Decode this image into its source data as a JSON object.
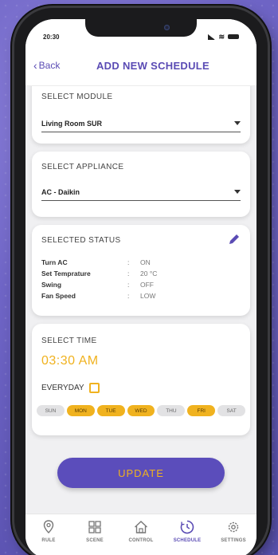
{
  "status_bar": {
    "time": "20:30"
  },
  "header": {
    "back_label": "Back",
    "title": "ADD NEW SCHEDULE"
  },
  "module": {
    "label": "SELECT MODULE",
    "value": "Living Room SUR"
  },
  "appliance": {
    "label": "SELECT APPLIANCE",
    "value": "AC - Daikin"
  },
  "selected_status": {
    "label": "SELECTED STATUS",
    "rows": [
      {
        "key": "Turn AC",
        "sep": ":",
        "value": "ON"
      },
      {
        "key": "Set Temprature",
        "sep": ":",
        "value": "20 °C"
      },
      {
        "key": "Swing",
        "sep": ":",
        "value": "OFF"
      },
      {
        "key": "Fan Speed",
        "sep": ":",
        "value": "LOW"
      }
    ]
  },
  "time": {
    "label": "SELECT TIME",
    "value": "03:30 AM",
    "everyday_label": "EVERYDAY",
    "everyday_checked": false,
    "days": [
      {
        "label": "SUN",
        "selected": false
      },
      {
        "label": "MON",
        "selected": true
      },
      {
        "label": "TUE",
        "selected": true
      },
      {
        "label": "WED",
        "selected": true
      },
      {
        "label": "THU",
        "selected": false
      },
      {
        "label": "FRI",
        "selected": true
      },
      {
        "label": "SAT",
        "selected": false
      }
    ]
  },
  "update_button": {
    "label": "UPDATE"
  },
  "tabbar": {
    "items": [
      {
        "label": "RULE",
        "icon": "location-pin-icon",
        "active": false
      },
      {
        "label": "SCENE",
        "icon": "scene-grid-icon",
        "active": false
      },
      {
        "label": "CONTROL",
        "icon": "house-icon",
        "active": false
      },
      {
        "label": "SCHEDULE",
        "icon": "clock-icon",
        "active": true
      },
      {
        "label": "SETTINGS",
        "icon": "gear-icon",
        "active": false
      }
    ]
  },
  "colors": {
    "primary": "#5a4bb4",
    "accent": "#f0b21f"
  }
}
